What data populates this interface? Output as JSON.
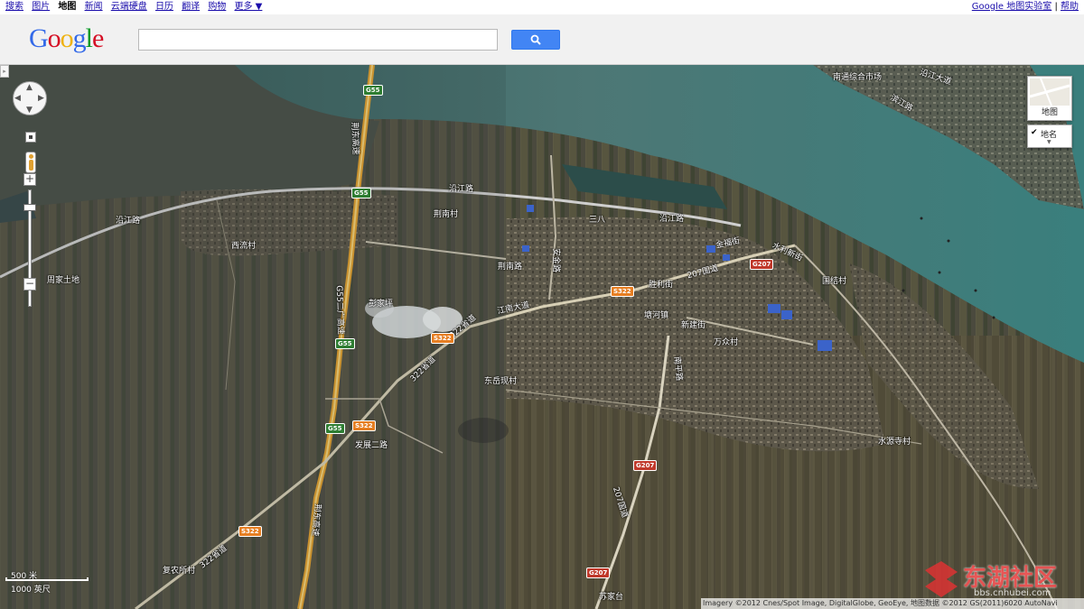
{
  "topnav": {
    "links": [
      "搜索",
      "图片",
      "地图",
      "新闻",
      "云端硬盘",
      "日历",
      "翻译",
      "购物",
      "更多 ▼"
    ],
    "active": "地图",
    "right_link": "Google 地图实验室",
    "separator": "|",
    "help": "帮助"
  },
  "header": {
    "logo": [
      "G",
      "o",
      "o",
      "g",
      "l",
      "e"
    ],
    "search_value": ""
  },
  "map": {
    "controls": {
      "maptype_label": "地图",
      "labels_toggle": "地名",
      "zoom_in": "+",
      "zoom_out": "−"
    },
    "scale": {
      "metric": "500 米",
      "imperial": "1000 英尺"
    },
    "copyright": "Imagery ©2012 Cnes/Spot Image, DigitalGlobe, GeoEye, 地图数据 ©2012 GS(2011)6020 AutoNavi",
    "watermark": {
      "name": "东湖社区",
      "url": "bbs.cnhubei.com"
    },
    "labels": [
      {
        "id": "yanjiang-w",
        "text": "沿江路"
      },
      {
        "id": "yanjiang-n",
        "text": "沿江路"
      },
      {
        "id": "yanjiang-e",
        "text": "沿江路"
      },
      {
        "id": "xiliu",
        "text": "西流村"
      },
      {
        "id": "zhoujia",
        "text": "周家土地"
      },
      {
        "id": "jingnan",
        "text": "荆南村"
      },
      {
        "id": "jingnan-rd",
        "text": "荆南路"
      },
      {
        "id": "pengjia",
        "text": "彭家坪"
      },
      {
        "id": "sanba",
        "text": "三八"
      },
      {
        "id": "anjin",
        "text": "安金路"
      },
      {
        "id": "shengli",
        "text": "胜利街"
      },
      {
        "id": "tanghe",
        "text": "塘河镇"
      },
      {
        "id": "xinjian",
        "text": "新建街"
      },
      {
        "id": "wanzhong",
        "text": "万众村"
      },
      {
        "id": "jiangnan",
        "text": "江南大道"
      },
      {
        "id": "dongyue",
        "text": "东岳现村"
      },
      {
        "id": "fazhan",
        "text": "发展二路"
      },
      {
        "id": "gd207",
        "text": "207国道"
      },
      {
        "id": "gd207b",
        "text": "207国道"
      },
      {
        "id": "shuili",
        "text": "水利新街"
      },
      {
        "id": "jiefang",
        "text": "金福街"
      },
      {
        "id": "guojie",
        "text": "国结村"
      },
      {
        "id": "shuiyuan",
        "text": "水源寺村"
      },
      {
        "id": "nanping",
        "text": "南平路"
      },
      {
        "id": "fu-nong",
        "text": "复农所村"
      },
      {
        "id": "sujia",
        "text": "苏家台"
      },
      {
        "id": "jingdong1",
        "text": "荆东高速"
      },
      {
        "id": "jingdong2",
        "text": "荆东高速"
      },
      {
        "id": "g55guang",
        "text": "G55二广高速"
      },
      {
        "id": "s322a",
        "text": "322省道"
      },
      {
        "id": "s322b",
        "text": "322省道"
      },
      {
        "id": "s322c",
        "text": "322省道"
      },
      {
        "id": "huadong",
        "text": "南通综合市场"
      },
      {
        "id": "yanjiang-ne",
        "text": "沿江大道"
      },
      {
        "id": "binjiang",
        "text": "滨江路"
      }
    ],
    "shields": [
      {
        "id": "g55-1",
        "text": "G55",
        "type": "g"
      },
      {
        "id": "g55-2",
        "text": "G55",
        "type": "g"
      },
      {
        "id": "g55-3",
        "text": "G55",
        "type": "g"
      },
      {
        "id": "g55-4",
        "text": "G55",
        "type": "g"
      },
      {
        "id": "s322-1",
        "text": "S322",
        "type": "s"
      },
      {
        "id": "s322-2",
        "text": "S322",
        "type": "s"
      },
      {
        "id": "s322-3",
        "text": "S322",
        "type": "s"
      },
      {
        "id": "s322-4",
        "text": "S322",
        "type": "s"
      },
      {
        "id": "g207-1",
        "text": "G207",
        "type": "r"
      },
      {
        "id": "g207-2",
        "text": "G207",
        "type": "r"
      },
      {
        "id": "g207-3",
        "text": "G207",
        "type": "r"
      }
    ]
  }
}
